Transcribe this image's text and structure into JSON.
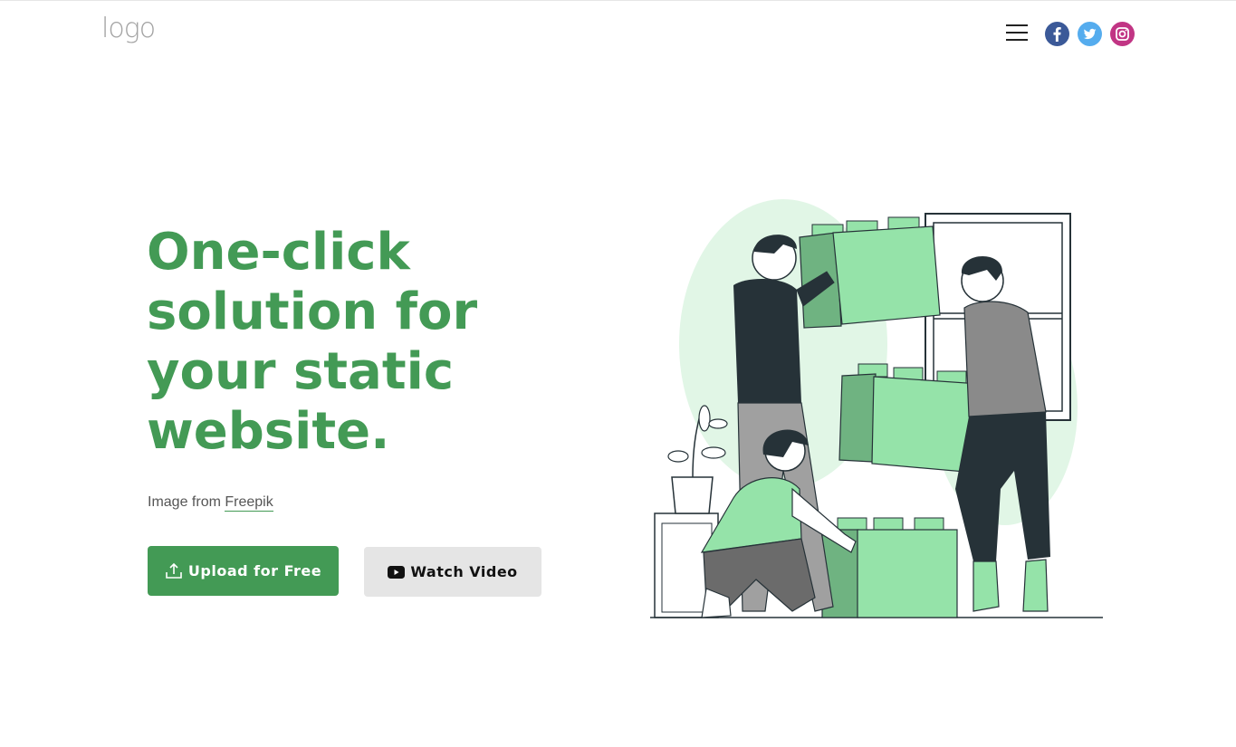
{
  "header": {
    "logo_text": "logo",
    "menu_icon": "hamburger-menu-icon",
    "social": [
      {
        "name": "facebook-icon",
        "color": "#3b5998"
      },
      {
        "name": "twitter-icon",
        "color": "#55acee"
      },
      {
        "name": "instagram-icon",
        "color": "#c13584"
      }
    ]
  },
  "hero": {
    "title": "One-click solution for your static website.",
    "credit_prefix": "Image from ",
    "credit_link": "Freepik",
    "upload_label": "Upload for Free",
    "video_label": "Watch Video"
  },
  "colors": {
    "accent": "#439a55",
    "light_green": "#95e3a9",
    "dark": "#263238",
    "secondary_button": "#e5e5e5"
  }
}
